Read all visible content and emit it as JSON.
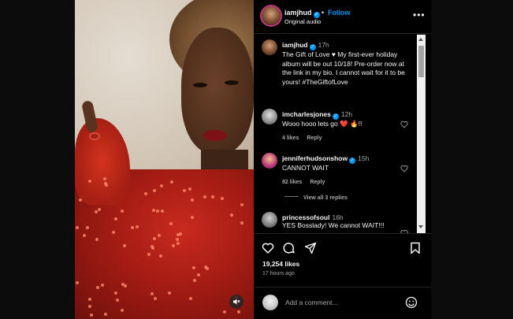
{
  "header": {
    "username": "iamjhud",
    "separator": "•",
    "follow_label": "Follow",
    "audio": "Original audio",
    "more_label": "•••"
  },
  "caption": {
    "username": "iamjhud",
    "time": "17h",
    "text": "The Gift of Love ♥ My first-ever holiday album will be out 10/18! Pre-order now at the link in my bio. I cannot wait for it to be yours! #TheGiftofLove"
  },
  "comments": [
    {
      "username": "imcharlesjones",
      "time": "12h",
      "text": "Wooo hooo lets go ❤️ 🔥!!",
      "likes": "4 likes",
      "reply": "Reply"
    },
    {
      "username": "jenniferhudsonshow",
      "time": "15h",
      "text": "CANNOT WAIT",
      "likes": "82 likes",
      "reply": "Reply",
      "view_replies": "View all 3 replies"
    },
    {
      "username": "princessofsoul",
      "time": "16h",
      "text": "YES Bosslady! We cannot WAIT!!!"
    }
  ],
  "post": {
    "likes": "19,254 likes",
    "time_ago": "17 hours ago"
  },
  "add_comment": {
    "placeholder": "Add a comment..."
  },
  "colors": {
    "accent": "#0095f6",
    "muted": "#a8a8a8",
    "like_red": "#ed4956"
  },
  "icons": [
    "heart-icon",
    "comment-icon",
    "share-icon",
    "bookmark-icon",
    "emoji-icon",
    "mute-icon",
    "verified-icon",
    "more-icon"
  ]
}
